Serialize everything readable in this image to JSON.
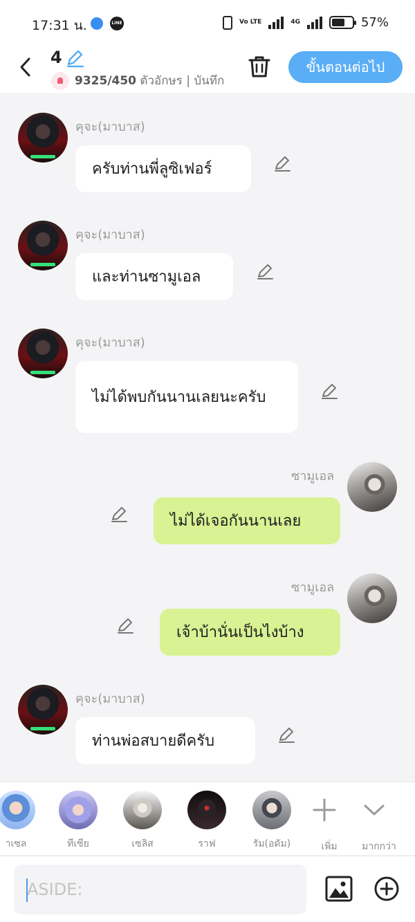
{
  "status_bar": {
    "time": "17:31 น.",
    "app_icons": [
      "send-icon",
      "line-icon"
    ],
    "line_label": "LINE",
    "volte": "Vo LTE",
    "network": "4G",
    "battery": "57%"
  },
  "header": {
    "episode": "4",
    "char_count": "9325/450",
    "char_label": "ตัวอักษร | บันทึก",
    "next_button": "ขั้นตอนต่อไป"
  },
  "messages": [
    {
      "side": "left",
      "sender": "คุจะ(มาบาส)",
      "text": "ครับท่านพี่ลูซิเฟอร์"
    },
    {
      "side": "left",
      "sender": "คุจะ(มาบาส)",
      "text": "และท่านซามูเอล"
    },
    {
      "side": "left",
      "sender": "คุจะ(มาบาส)",
      "text": "ไม่ได้พบกันนานเลยนะครับ"
    },
    {
      "side": "right",
      "sender": "ซามูเอล",
      "text": "ไม่ได้เจอกันนานเลย"
    },
    {
      "side": "right",
      "sender": "ซามูเอล",
      "text": "เจ้าบ้านั่นเป็นไงบ้าง"
    },
    {
      "side": "left",
      "sender": "คุจะ(มาบาส)",
      "text": "ท่านพ่อสบายดีครับ"
    }
  ],
  "characters": {
    "items": [
      {
        "label": "าเซล"
      },
      {
        "label": "ทีเซีย"
      },
      {
        "label": "เซลิส"
      },
      {
        "label": "ราฟ"
      },
      {
        "label": "รัม(อดัม)"
      }
    ],
    "add_label": "เพิ่ม",
    "more_label": "มากกว่า"
  },
  "composer": {
    "placeholder": "ASIDE:",
    "value": ""
  },
  "colors": {
    "accent": "#5aaef5",
    "right_bubble": "#d8f294",
    "left_bubble": "#ffffff",
    "background": "#f4f4f6"
  }
}
